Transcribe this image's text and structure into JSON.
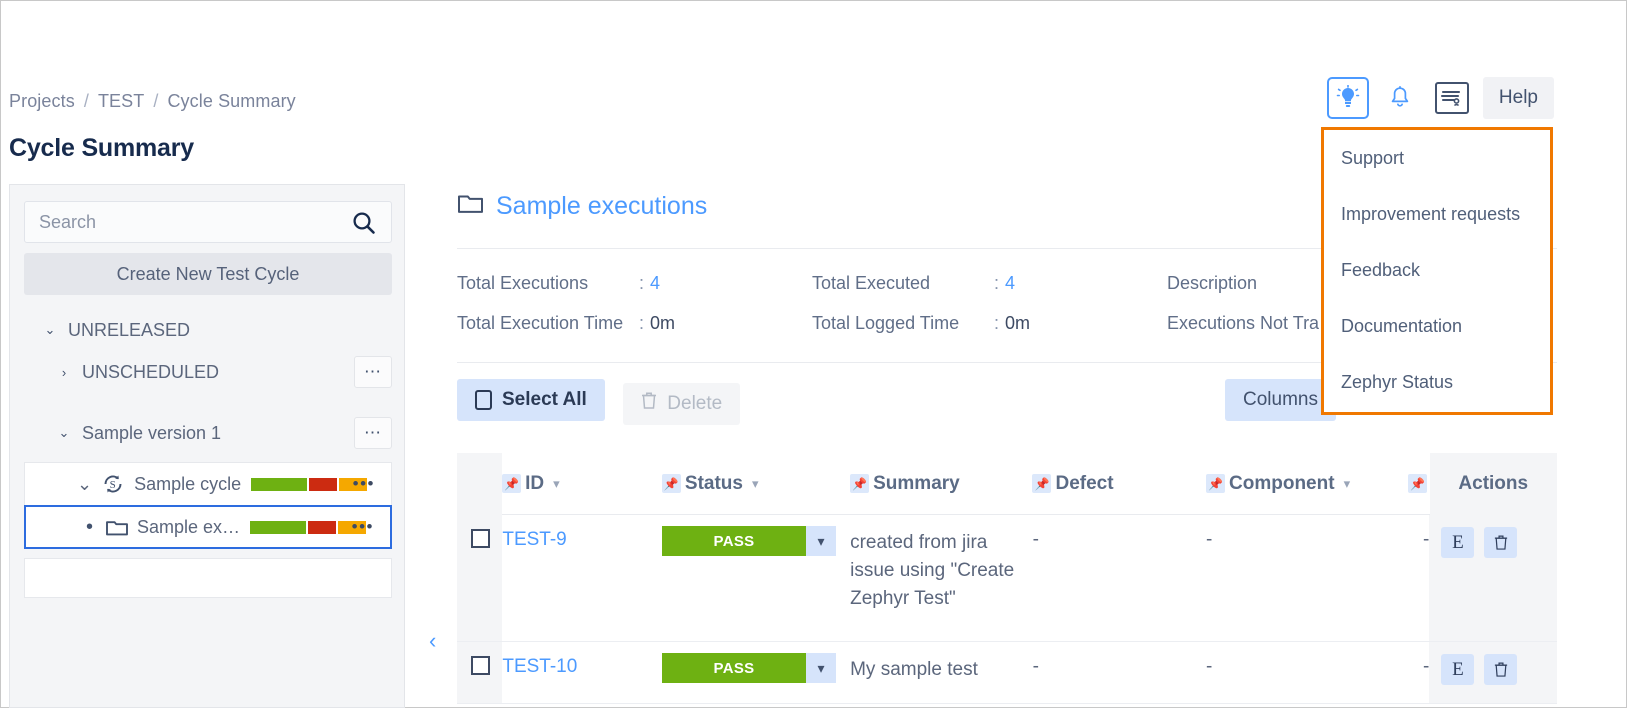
{
  "breadcrumb": {
    "items": [
      "Projects",
      "TEST",
      "Cycle Summary"
    ],
    "separator": "/"
  },
  "page": {
    "title": "Cycle Summary"
  },
  "topbar": {
    "tip_icon": "lightbulb-icon",
    "notification_icon": "bell-icon",
    "vision_icon": "accessibility-icon",
    "help_label": "Help"
  },
  "help_menu": {
    "border_color": "#f07800",
    "items": [
      "Support",
      "Improvement requests",
      "Feedback",
      "Documentation",
      "Zephyr Status"
    ]
  },
  "sidebar": {
    "search": {
      "placeholder": "Search",
      "value": "",
      "icon": "search-icon"
    },
    "create_button": "Create New Test Cycle",
    "tree": [
      {
        "label": "UNRELEASED",
        "caret": "⌄",
        "level": 0,
        "dots": false
      },
      {
        "label": "UNSCHEDULED",
        "caret": "›",
        "level": 1,
        "dots": true
      },
      {
        "label": "Sample version 1",
        "caret": "⌄",
        "level": 1,
        "dots": true
      }
    ],
    "cycle": {
      "label": "Sample cycle",
      "caret": "⌄",
      "icon": "cycle-icon",
      "dots": "•••"
    },
    "folder": {
      "label": "Sample ex…",
      "bullet": "•",
      "icon": "folder-icon",
      "dots": "•••",
      "selected": true
    },
    "progress_colors": {
      "pass": "#6eb112",
      "fail": "#cc2b11",
      "wip": "#f5a800"
    },
    "progress_widths": [
      56,
      28,
      28
    ]
  },
  "main": {
    "folder_icon": "folder-icon",
    "folder_title": "Sample executions",
    "summary": [
      [
        {
          "label": "Total Executions",
          "colon": ":",
          "value": "4",
          "accent": true
        },
        {
          "label": "Total Executed",
          "colon": ":",
          "value": "4",
          "accent": true
        },
        {
          "label": "Description",
          "colon": "",
          "value": "",
          "accent": false
        }
      ],
      [
        {
          "label": "Total Execution Time",
          "colon": ":",
          "value": "0m",
          "accent": false
        },
        {
          "label": "Total Logged Time",
          "colon": ":",
          "value": "0m",
          "accent": false
        },
        {
          "label": "Executions Not Tra",
          "colon": "",
          "value": "",
          "accent": false
        }
      ]
    ],
    "toolbar": {
      "select_all_label": "Select All",
      "select_all_icon": "checkbox-icon",
      "delete_label": "Delete",
      "delete_icon": "trash-icon",
      "columns_label": "Columns"
    },
    "table": {
      "pin_icon": "pin-icon",
      "columns": [
        {
          "key": "chk",
          "label": "",
          "pin": false,
          "caret": false
        },
        {
          "key": "id",
          "label": "ID",
          "pin": true,
          "caret": true
        },
        {
          "key": "status",
          "label": "Status",
          "pin": true,
          "caret": true
        },
        {
          "key": "sum",
          "label": "Summary",
          "pin": true,
          "caret": false
        },
        {
          "key": "def",
          "label": "Defect",
          "pin": true,
          "caret": false
        },
        {
          "key": "comp",
          "label": "Component",
          "pin": true,
          "caret": true
        },
        {
          "key": "act",
          "label": "Actions",
          "pin": true,
          "caret": false
        }
      ],
      "rows": [
        {
          "checked": false,
          "id": "TEST-9",
          "status": "PASS",
          "status_color": "#6eb112",
          "summary": "created from jira issue using \"Create Zephyr Test\"",
          "defect": "-",
          "component": "-",
          "actions": {
            "edit": "E",
            "delete": "trash-icon"
          }
        },
        {
          "checked": false,
          "id": "TEST-10",
          "status": "PASS",
          "status_color": "#6eb112",
          "summary": "My sample test",
          "defect": "-",
          "component": "-",
          "actions": {
            "edit": "E",
            "delete": "trash-icon"
          }
        }
      ]
    },
    "collapse_handle": "‹"
  }
}
